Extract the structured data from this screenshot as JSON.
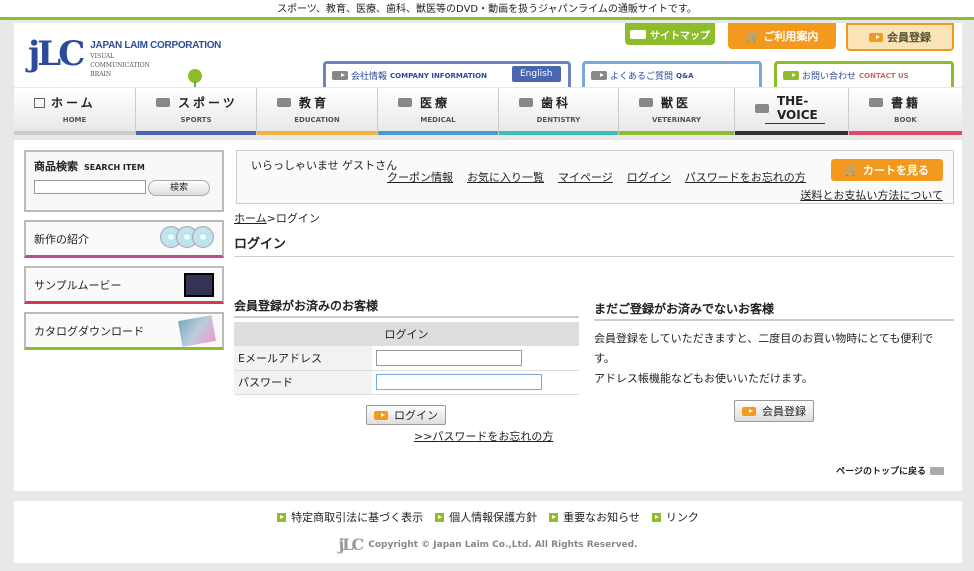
{
  "topbar": {
    "text": "スポーツ、教育、医療、歯科、獣医等のDVD・動画を扱うジャパンライムの通販サイトです。"
  },
  "logo": {
    "mark": "jLC",
    "corp": "JAPAN LAIM CORPORATION",
    "sub1": "VISUAL",
    "sub2": "COMMUNICATION",
    "sub3": "BRAIN"
  },
  "header": {
    "sitemap": "サイトマップ",
    "guide": "ご利用案内",
    "register": "会員登録",
    "company_jp": "会社情報",
    "company_en": "COMPANY INFORMATION",
    "english": "English",
    "faq_jp": "よくあるご質問",
    "faq_en": "Q&A",
    "contact_jp": "お問い合わせ",
    "contact_en": "CONTACT US"
  },
  "nav": [
    {
      "jp": "ホーム",
      "en": "HOME",
      "color": "#cccccc"
    },
    {
      "jp": "スポーツ",
      "en": "SPORTS",
      "color": "#4a66b0"
    },
    {
      "jp": "教育",
      "en": "EDUCATION",
      "color": "#f3b23a"
    },
    {
      "jp": "医療",
      "en": "MEDICAL",
      "color": "#4a9ad8"
    },
    {
      "jp": "歯科",
      "en": "DENTISTRY",
      "color": "#3abfb0"
    },
    {
      "jp": "獣医",
      "en": "VETERINARY",
      "color": "#8ebd2c"
    },
    {
      "jp": "THE-VOICE",
      "en": "",
      "color": "#333333"
    },
    {
      "jp": "書籍",
      "en": "BOOK",
      "color": "#e04a6a"
    }
  ],
  "sidebar": {
    "search_title": "商品検索",
    "search_en": "SEARCH ITEM",
    "search_button": "検索",
    "new": "新作の紹介",
    "movie": "サンプルムービー",
    "catalog": "カタログダウンロード"
  },
  "welcome": {
    "greeting": "いらっしゃいませ ゲストさん",
    "links": [
      "クーポン情報",
      "お気に入り一覧",
      "マイページ",
      "ログイン",
      "パスワードをお忘れの方"
    ],
    "cart": "カートを見る",
    "shipping": "送料とお支払い方法について"
  },
  "breadcrumb": {
    "home": "ホーム",
    "sep": ">",
    "current": "ログイン"
  },
  "page_title": "ログイン",
  "login": {
    "section_title": "会員登録がお済みのお客様",
    "table_header": "ログイン",
    "email_label": "Eメールアドレス",
    "password_label": "パスワード",
    "email_value": "",
    "password_value": "",
    "button": "ログイン",
    "forgot": ">>パスワードをお忘れの方"
  },
  "register": {
    "section_title": "まだご登録がお済みでないお客様",
    "text1": "会員登録をしていただきますと、二度目のお買い物時にとても便利です。",
    "text2": "アドレス帳機能などもお使いいただけます。",
    "button": "会員登録"
  },
  "pagetop": "ページのトップに戻る",
  "footer": {
    "links": [
      "特定商取引法に基づく表示",
      "個人情報保護方針",
      "重要なお知らせ",
      "リンク"
    ],
    "logo": "jLC",
    "copyright": "Copyright © Japan Laim Co.,Ltd. All Rights Reserved."
  }
}
